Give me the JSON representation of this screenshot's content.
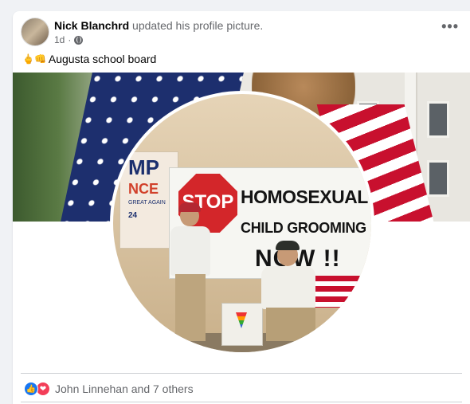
{
  "post": {
    "author": "Nick Blanchrd",
    "action": "updated his profile picture.",
    "time": "1d",
    "more_label": "•••",
    "text": "Augusta school board",
    "text_emojis": "🖕👊"
  },
  "photo": {
    "stop_sign": "STOP",
    "banner_line1": "HOMOSEXUAL",
    "banner_line2": "CHILD GROOMING",
    "banner_line3": "NOW !!",
    "poster_mp": "MP",
    "poster_nce": "NCE",
    "poster_great": "GREAT AGAIN",
    "poster_24": "24"
  },
  "reactions": {
    "text": "John Linnehan and 7 others",
    "like_icon": "👍",
    "love_icon": "❤"
  }
}
